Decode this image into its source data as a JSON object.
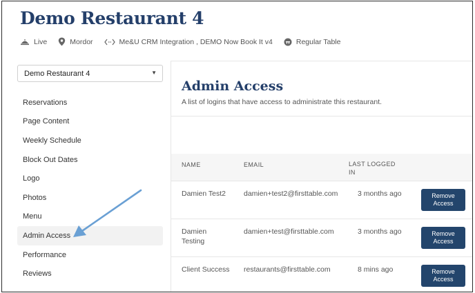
{
  "header": {
    "title": "Demo Restaurant 4",
    "meta": [
      {
        "icon": "live-icon",
        "label": "Live"
      },
      {
        "icon": "location-pin-icon",
        "label": "Mordor"
      },
      {
        "icon": "integration-icon",
        "label": "Me&U CRM Integration , DEMO Now Book It v4"
      },
      {
        "icon": "table-icon",
        "label": "Regular Table"
      }
    ]
  },
  "restaurant_select": {
    "value": "Demo Restaurant 4"
  },
  "sidebar": {
    "items": [
      {
        "label": "Reservations"
      },
      {
        "label": "Page Content"
      },
      {
        "label": "Weekly Schedule"
      },
      {
        "label": "Block Out Dates"
      },
      {
        "label": "Logo"
      },
      {
        "label": "Photos"
      },
      {
        "label": "Menu"
      },
      {
        "label": "Admin Access"
      },
      {
        "label": "Performance"
      },
      {
        "label": "Reviews"
      }
    ],
    "active": "Admin Access"
  },
  "main": {
    "title": "Admin Access",
    "subtitle": "A list of logins that have access to administrate this restaurant.",
    "table": {
      "columns": {
        "name": "NAME",
        "email": "EMAIL",
        "last": "LAST LOGGED IN"
      },
      "rows": [
        {
          "name": "Damien Test2",
          "email": "damien+test2@firsttable.com",
          "last": "3 months ago",
          "action": "Remove Access"
        },
        {
          "name": "Damien Testing",
          "email": "damien+test@firsttable.com",
          "last": "3 months ago",
          "action": "Remove Access"
        },
        {
          "name": "Client Success",
          "email": "restaurants@firsttable.com",
          "last": "8 mins ago",
          "action": "Remove Access"
        }
      ]
    }
  },
  "colors": {
    "brand_navy": "#243f6a",
    "button_navy": "#23456c",
    "annotation_arrow": "#6aa0d4"
  }
}
